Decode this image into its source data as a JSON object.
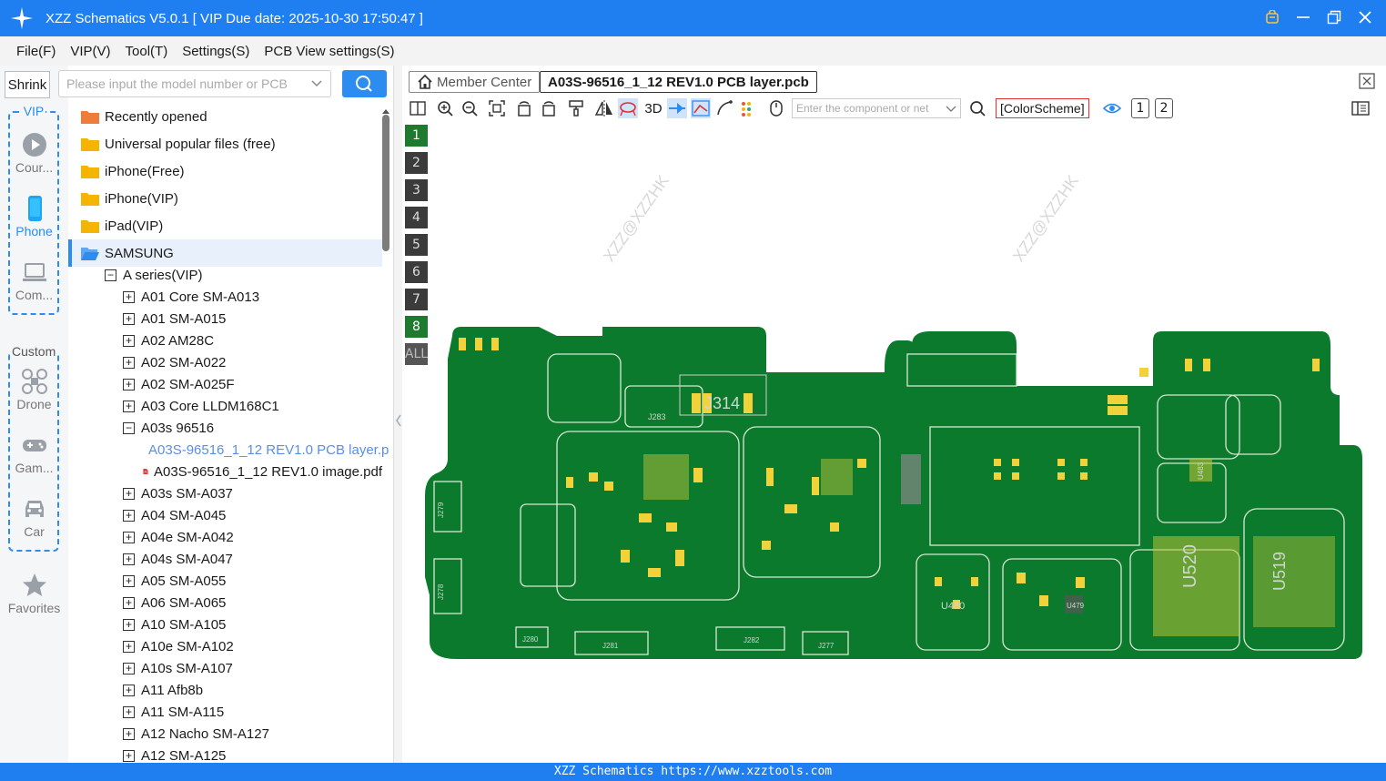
{
  "window": {
    "title": "XZZ Schematics V5.0.1 [ VIP Due date: 2025-10-30 17:50:47 ]"
  },
  "menu": [
    "File(F)",
    "VIP(V)",
    "Tool(T)",
    "Settings(S)",
    "PCB View settings(S)"
  ],
  "sidebar": {
    "shrink_label": "Shrink",
    "vip_label": "VIP",
    "custom_label": "Custom",
    "items": [
      {
        "label": "Cour...",
        "icon": "play-icon"
      },
      {
        "label": "Phone",
        "icon": "phone-icon"
      },
      {
        "label": "Com...",
        "icon": "laptop-icon"
      },
      {
        "label": "Drone",
        "icon": "drone-icon"
      },
      {
        "label": "Gam...",
        "icon": "gamepad-icon"
      },
      {
        "label": "Car",
        "icon": "car-icon"
      },
      {
        "label": "Favorites",
        "icon": "star-icon"
      }
    ]
  },
  "search": {
    "placeholder": "Please input the model number or PCB"
  },
  "tree": {
    "folders": [
      {
        "label": "Recently opened",
        "color": "#f07c3c"
      },
      {
        "label": "Universal popular files (free)",
        "color": "#f5b400"
      },
      {
        "label": "iPhone(Free)",
        "color": "#f5b400"
      },
      {
        "label": "iPhone(VIP)",
        "color": "#f5b400"
      },
      {
        "label": "iPad(VIP)",
        "color": "#f5b400"
      },
      {
        "label": "SAMSUNG",
        "color": "#2d8cf0"
      }
    ],
    "series": "A series(VIP)",
    "models_before": [
      "A01 Core SM-A013",
      "A01 SM-A015",
      "A02 AM28C",
      "A02 SM-A022",
      "A02 SM-A025F",
      "A03 Core LLDM168C1"
    ],
    "open_model": "A03s 96516",
    "files": [
      {
        "label": "A03S-96516_1_12 REV1.0 PCB layer.p",
        "type": "pcb",
        "color": "#5a8ee6"
      },
      {
        "label": "A03S-96516_1_12 REV1.0 image.pdf",
        "type": "pdf",
        "color": "#1a1a1a"
      }
    ],
    "models_after": [
      "A03s SM-A037",
      "A04 SM-A045",
      "A04e SM-A042",
      "A04s SM-A047",
      "A05 SM-A055",
      "A06 SM-A065",
      "A10 SM-A105",
      "A10e SM-A102",
      "A10s SM-A107",
      "A11 Afb8b",
      "A11 SM-A115",
      "A12 Nacho SM-A127",
      "A12 SM-A125"
    ]
  },
  "tabs": {
    "member_center": "Member Center",
    "file_tab": "A03S-96516_1_12 REV1.0 PCB layer.pcb"
  },
  "toolbar": {
    "three_d": "3D",
    "component_placeholder": "Enter the component or net",
    "color_scheme": "[ColorScheme]",
    "view1": "1",
    "view2": "2"
  },
  "layers": [
    "1",
    "2",
    "3",
    "4",
    "5",
    "6",
    "7",
    "8",
    "ALL"
  ],
  "pcb": {
    "watermark": "XZZ@XZZHK",
    "board_color": "#0b7a2c",
    "pad_color": "#f2d23a",
    "labels": [
      "J314",
      "J283",
      "J279",
      "J278",
      "J280",
      "J281",
      "J282",
      "J277",
      "U480",
      "U479",
      "U520",
      "U519",
      "U483"
    ]
  },
  "status": "XZZ Schematics https://www.xzztools.com"
}
